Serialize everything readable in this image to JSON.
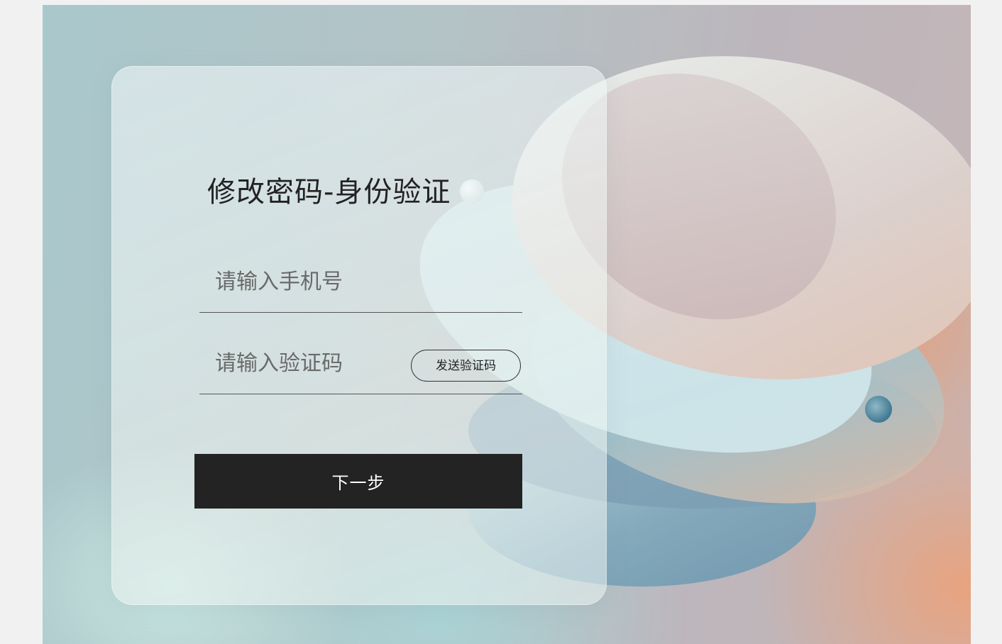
{
  "page": {
    "title": "修改密码-身份验证"
  },
  "form": {
    "phone_placeholder": "请输入手机号",
    "code_placeholder": "请输入验证码",
    "send_code_label": "发送验证码",
    "next_label": "下一步"
  },
  "colors": {
    "button_bg": "#232323",
    "button_text": "#ffffff",
    "accent_peach": "#eea076",
    "accent_teal": "#a8d6d8"
  },
  "icons": {
    "background": "decorative-3d-disc-illustration"
  }
}
